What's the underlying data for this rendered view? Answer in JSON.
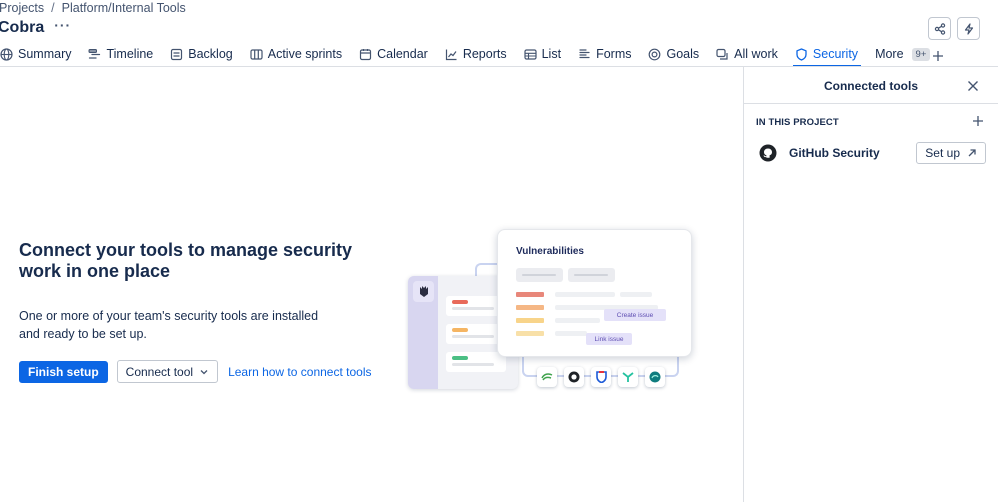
{
  "breadcrumb": {
    "items": [
      "Projects",
      "Platform/Internal Tools"
    ],
    "separator": "/"
  },
  "project": {
    "title": "Cobra",
    "more": "···"
  },
  "tabs": [
    {
      "label": "Summary",
      "icon": "globe-icon"
    },
    {
      "label": "Timeline",
      "icon": "timeline-icon"
    },
    {
      "label": "Backlog",
      "icon": "backlog-icon"
    },
    {
      "label": "Active sprints",
      "icon": "board-icon"
    },
    {
      "label": "Calendar",
      "icon": "calendar-icon"
    },
    {
      "label": "Reports",
      "icon": "chart-icon"
    },
    {
      "label": "List",
      "icon": "list-icon"
    },
    {
      "label": "Forms",
      "icon": "forms-icon"
    },
    {
      "label": "Goals",
      "icon": "target-icon"
    },
    {
      "label": "All work",
      "icon": "all-work-icon"
    },
    {
      "label": "Security",
      "icon": "shield-icon",
      "active": true
    },
    {
      "label": "More",
      "badge": "9+"
    }
  ],
  "main": {
    "headline": "Connect your tools to manage security work in one place",
    "description": "One or more of your team's security tools are installed and ready to be set up.",
    "finish_setup": "Finish setup",
    "connect_tool": "Connect tool",
    "learn_link": "Learn how to connect tools"
  },
  "illustration": {
    "card_title": "Vulnerabilities",
    "create_issue": "Create issue",
    "link_issue": "Link issue"
  },
  "panel": {
    "title": "Connected tools",
    "section": "IN THIS PROJECT",
    "tool_name": "GitHub Security",
    "setup_label": "Set up"
  },
  "colors": {
    "accent": "#0c66e4",
    "text": "#172b4d",
    "border": "#dcdfe4"
  }
}
